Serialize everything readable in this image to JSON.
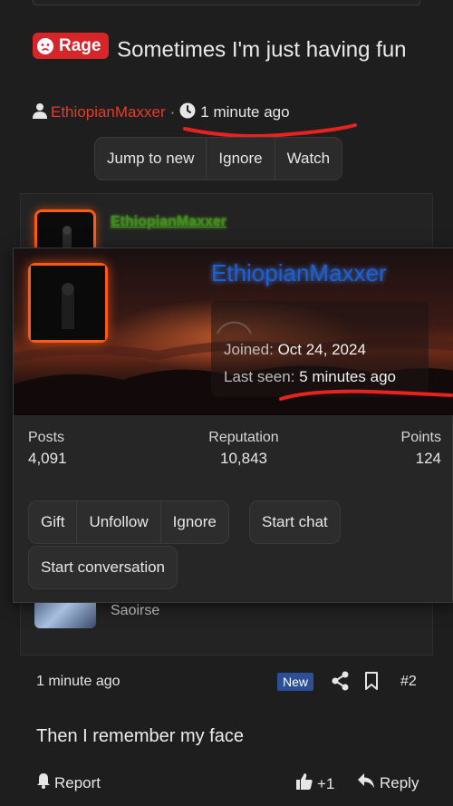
{
  "thread": {
    "prefix_label": "Rage",
    "title": "Sometimes I'm just having fun",
    "author": "EthiopianMaxxer",
    "separator": "·",
    "time": "1 minute ago",
    "prefix_color": "#d7262a",
    "author_color": "#e83a2a"
  },
  "thread_actions": [
    "Jump to new",
    "Ignore",
    "Watch"
  ],
  "message": {
    "username": "EthiopianMaxxer"
  },
  "member_card": {
    "name": "EthiopianMaxxer",
    "joined_label": "Joined:",
    "joined_value": "Oct 24, 2024",
    "last_seen_label": "Last seen:",
    "last_seen_value": "5 minutes ago",
    "stats": [
      {
        "label": "Posts",
        "value": "4,091"
      },
      {
        "label": "Reputation",
        "value": "10,843"
      },
      {
        "label": "Points",
        "value": "124"
      }
    ],
    "actions_group": [
      "Gift",
      "Unfollow",
      "Ignore"
    ],
    "start_chat": "Start chat",
    "start_conversation": "Start conversation",
    "name_color": "#1d5fd6",
    "avatar_border_color": "#ff5a14"
  },
  "quoted_user": "Saoirse",
  "post": {
    "time": "1 minute ago",
    "badge": "New",
    "number": "#2",
    "body": "Then I remember my face",
    "report_label": "Report",
    "like_count": "+1",
    "reply_label": "Reply"
  },
  "icons": [
    "angry-face-icon",
    "user-icon",
    "clock-icon",
    "share-icon",
    "bookmark-icon",
    "bell-icon",
    "thumbs-up-icon",
    "reply-icon"
  ]
}
